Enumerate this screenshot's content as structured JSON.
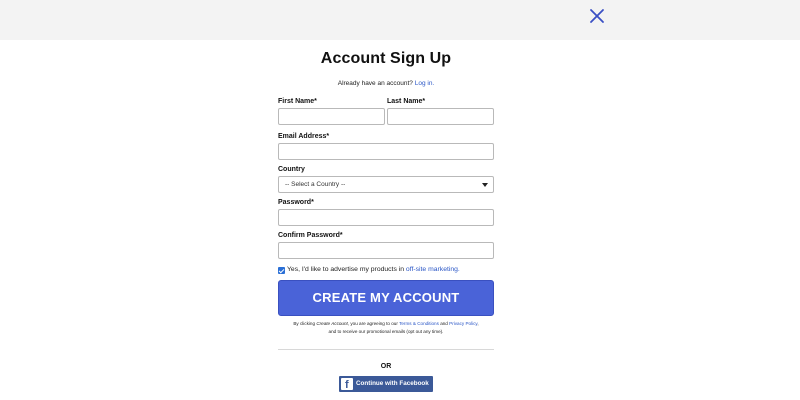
{
  "dialog": {
    "close_icon": "close-icon"
  },
  "form": {
    "title": "Account Sign Up",
    "login_prompt": "Already have an account?",
    "login_link": "Log in.",
    "first_name_label": "First Name*",
    "last_name_label": "Last Name*",
    "email_label": "Email Address*",
    "country_label": "Country",
    "country_selected": "-- Select a Country --",
    "password_label": "Password*",
    "confirm_password_label": "Confirm Password*",
    "marketing_text": "Yes, I'd like to advertise my products in",
    "marketing_link": "off-site marketing.",
    "marketing_checked": true,
    "submit_label": "CREATE MY ACCOUNT",
    "terms_prefix": "By clicking",
    "terms_emph": "Create Account",
    "terms_mid": ", you are agreeing to our",
    "terms_link": "Terms & Conditions",
    "terms_and": "and",
    "privacy_link": "Privacy Policy",
    "terms_line2": "and to receive our promotional emails (opt out any time).",
    "or_label": "OR",
    "facebook_label": "Continue with Facebook"
  },
  "colors": {
    "primary_button": "#4a63d8",
    "link": "#2a56c6",
    "facebook": "#3b5998",
    "close_icon": "#3a4fc4"
  }
}
